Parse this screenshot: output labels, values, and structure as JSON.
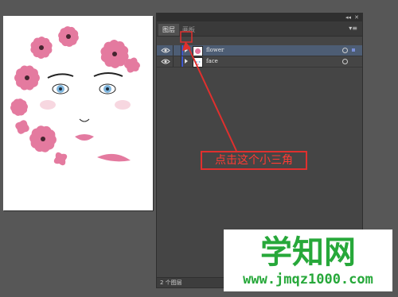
{
  "layers_panel": {
    "tabs": [
      {
        "label": "图层"
      },
      {
        "label": "画板"
      }
    ],
    "menu_icon": "panel-menu-icon",
    "layers": [
      {
        "name": "flower",
        "selected": true
      },
      {
        "name": "face",
        "selected": false
      }
    ],
    "footer": {
      "count_label": "2 个图层"
    }
  },
  "annotation": {
    "text": "点击这个小三角"
  },
  "watermark": {
    "title": "学知网",
    "url": "www.jmqz1000.com"
  },
  "colors": {
    "selected_row": "#4d5d74",
    "layer_color_bar": "#3e57c9",
    "annotation": "#e0302e",
    "watermark": "#27a83a",
    "petal": "#e3739a"
  }
}
